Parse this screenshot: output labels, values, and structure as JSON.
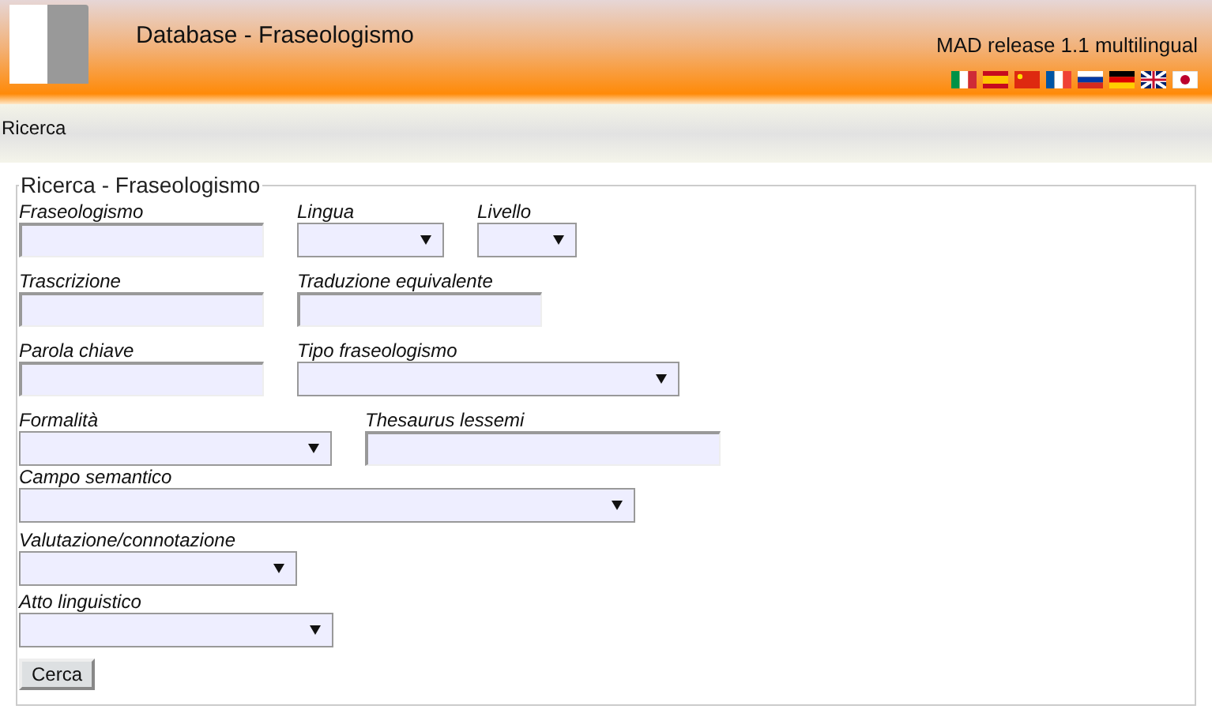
{
  "header": {
    "title": "Database - Fraseologismo",
    "release": "MAD release 1.1 multilingual"
  },
  "nav": {
    "items": [
      "Ricerca"
    ]
  },
  "form": {
    "legend": "Ricerca - Fraseologismo",
    "rows": [
      [
        {
          "kind": "text",
          "label": "Fraseologismo"
        },
        {
          "kind": "select",
          "label": "Lingua"
        },
        {
          "kind": "select",
          "label": "Livello"
        }
      ],
      [
        {
          "kind": "text",
          "label": "Trascrizione"
        },
        {
          "kind": "text",
          "label": "Traduzione equivalente"
        }
      ],
      [
        {
          "kind": "text",
          "label": "Parola chiave"
        },
        {
          "kind": "select",
          "label": "Tipo fraseologismo"
        }
      ],
      [
        {
          "kind": "select",
          "label": "Formalità"
        },
        {
          "kind": "text",
          "label": "Thesaurus lessemi"
        }
      ],
      [
        {
          "kind": "select",
          "label": "Campo semantico"
        }
      ],
      [
        {
          "kind": "select",
          "label": "Valutazione/connotazione"
        }
      ],
      [
        {
          "kind": "select",
          "label": "Atto linguistico"
        }
      ]
    ],
    "button": "Cerca"
  }
}
